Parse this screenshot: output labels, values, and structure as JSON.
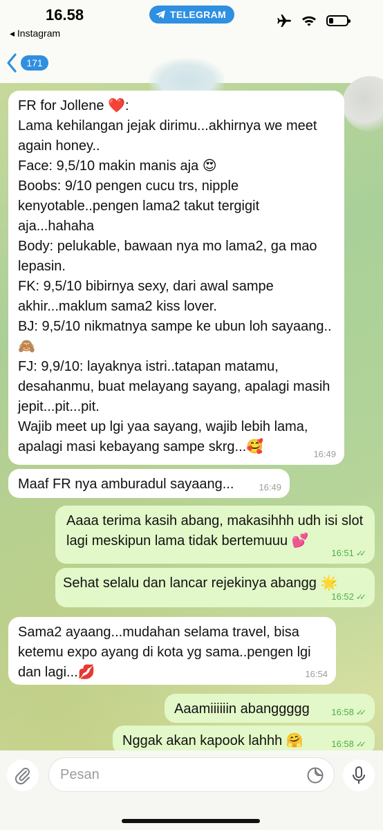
{
  "status_bar": {
    "time": "16.58",
    "back_app": "◂ Instagram",
    "pill": "TELEGRAM",
    "icons": [
      "airplane-icon",
      "wifi-icon",
      "battery-icon"
    ]
  },
  "header": {
    "back_count": "171"
  },
  "messages": [
    {
      "dir": "in",
      "text": "FR for Jollene ❤️:\nLama kehilangan jejak dirimu...akhirnya we meet again honey..\nFace: 9,5/10 makin manis aja 😍\nBoobs: 9/10 pengen cucu trs, nipple kenyotable..pengen lama2 takut tergigit aja...hahaha\nBody: pelukable, bawaan nya mo lama2, ga mao lepasin.\nFK: 9,5/10 bibirnya sexy, dari awal sampe akhir...maklum sama2 kiss lover.\nBJ: 9,5/10 nikmatnya sampe ke ubun loh sayaang..🙈\nFJ: 9,9/10: layaknya istri..tatapan matamu, desahanmu, buat melayang sayang, apalagi masih jepit...pit...pit.\nWajib meet up lgi yaa sayang, wajib lebih lama, apalagi masi kebayang sampe skrg...🥰",
      "time": "16:49"
    },
    {
      "dir": "in",
      "text": "Maaf FR nya amburadul sayaang...",
      "time": "16:49"
    },
    {
      "dir": "out",
      "text": "Aaaa terima kasih abang, makasihhh udh isi slot lagi meskipun lama tidak bertemuuu 💕",
      "time": "16:51"
    },
    {
      "dir": "out",
      "text": "Sehat selalu dan lancar rejekinya abangg 🌟",
      "time": "16:52"
    },
    {
      "dir": "in",
      "text": "Sama2 ayaang...mudahan selama travel, bisa ketemu expo ayang di kota yg sama..pengen lgi dan lagi...💋",
      "time": "16:54"
    },
    {
      "dir": "out",
      "text": "Aaamiiiiiin abanggggg",
      "time": "16:58"
    },
    {
      "dir": "out",
      "text": "Nggak akan kapook lahhh 🤗",
      "time": "16:58"
    }
  ],
  "input": {
    "placeholder": "Pesan",
    "icons": [
      "paperclip-icon",
      "sticker-icon",
      "microphone-icon"
    ]
  },
  "colors": {
    "accent": "#2f8fe0",
    "incoming_bubble": "#ffffff",
    "outgoing_bubble": "#e2f8c8",
    "outgoing_meta": "#4fae4e"
  }
}
